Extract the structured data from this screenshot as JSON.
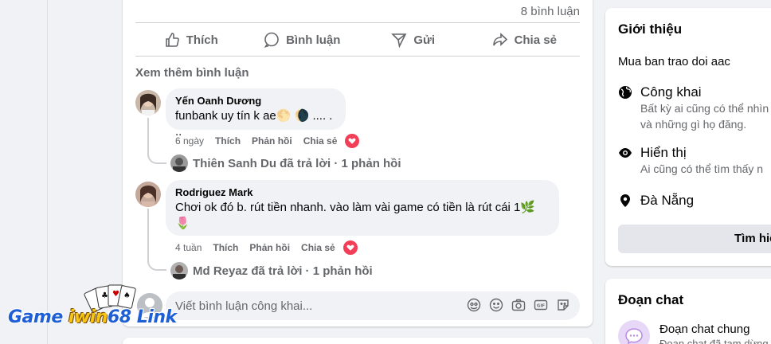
{
  "post": {
    "comment_count": "8 bình luận",
    "actions": [
      {
        "label": "Thích",
        "icon": "like-icon"
      },
      {
        "label": "Bình luận",
        "icon": "comment-icon"
      },
      {
        "label": "Gửi",
        "icon": "send-icon"
      },
      {
        "label": "Chia sẻ",
        "icon": "share-icon"
      }
    ],
    "more_comments": "Xem thêm bình luận",
    "comments": [
      {
        "author": "Yến Oanh Dương",
        "text": "funbank uy tín k ae🌕 🌘 .... . ..",
        "time": "6 ngày",
        "like": "Thích",
        "reply": "Phản hồi",
        "share": "Chia sẻ",
        "reaction": "heart-icon",
        "reply_summary": "Thiên Sanh Du đã trả lời · 1 phản hồi"
      },
      {
        "author": "Rodriguez Mark",
        "text_line1": "Chơi ok đó b. rút tiền nhanh. vào làm vài game có tiền là rút cái 1🌿",
        "text_line2": "🌷",
        "time": "4 tuần",
        "like": "Thích",
        "reply": "Phản hồi",
        "share": "Chia sẻ",
        "reaction": "heart-icon",
        "reply_summary": "Md Reyaz đã trả lời · 1 phản hồi"
      }
    ],
    "composer_placeholder": "Viết bình luận công khai...",
    "composer_tools": [
      "avatar-sticker-icon",
      "emoji-icon",
      "camera-icon",
      "gif-icon",
      "sticker-icon"
    ]
  },
  "intro": {
    "title": "Giới thiệu",
    "description": "Mua ban trao doi aac",
    "items": [
      {
        "icon": "globe-icon",
        "title": "Công khai",
        "sub1": "Bất kỳ ai cũng có thể nhìn",
        "sub2": "và những gì họ đăng."
      },
      {
        "icon": "eye-icon",
        "title": "Hiển thị",
        "sub1": "Ai cũng có thể tìm thấy n",
        "sub2": ""
      },
      {
        "icon": "location-icon",
        "title": "Đà Nẵng",
        "sub1": "",
        "sub2": ""
      }
    ],
    "button": "Tìm hiể"
  },
  "chat": {
    "title": "Đoạn chat",
    "name": "Đoạn chat chung",
    "sub": "Đoạn chat đã tạm dừng"
  },
  "watermark": {
    "part1": "Game ",
    "part2": "iwin",
    "part3": "68 Link"
  },
  "colors": {
    "background": "#f0f2f5",
    "muted_text": "#65676b",
    "heart": "#f33e58",
    "watermark_blue": "#1e5fd6"
  }
}
